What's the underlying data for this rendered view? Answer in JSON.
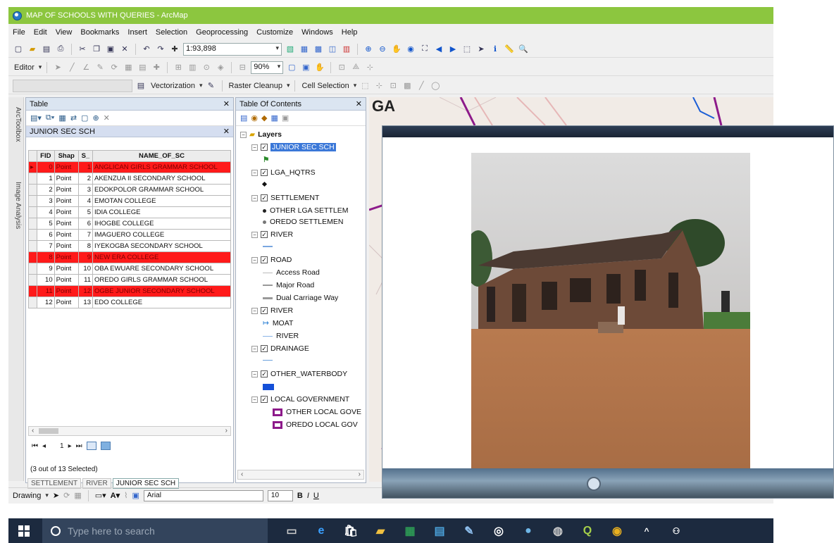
{
  "window": {
    "title": "MAP OF SCHOOLS WITH QUERIES - ArcMap"
  },
  "menu": [
    "File",
    "Edit",
    "View",
    "Bookmarks",
    "Insert",
    "Selection",
    "Geoprocessing",
    "Customize",
    "Windows",
    "Help"
  ],
  "toolbar": {
    "scale": "1:93,898",
    "editor_label": "Editor",
    "zoom_pct": "90%",
    "vectorization_label": "Vectorization",
    "raster_cleanup_label": "Raster Cleanup",
    "cell_selection_label": "Cell Selection"
  },
  "side_tabs": {
    "arctoolbox": "ArcToolbox",
    "image_analysis": "Image Analysis"
  },
  "table": {
    "panel_title": "Table",
    "layer_name": "JUNIOR SEC SCH",
    "columns": [
      "FID",
      "Shap",
      "S_",
      "NAME_OF_SC"
    ],
    "rows": [
      {
        "fid": "0",
        "shape": "Point",
        "s": "1",
        "name": "ANGLICAN GIRLS GRAMMAR SCHOOL",
        "selected": true
      },
      {
        "fid": "1",
        "shape": "Point",
        "s": "2",
        "name": "AKENZUA II SECONDARY SCHOOL",
        "selected": false
      },
      {
        "fid": "2",
        "shape": "Point",
        "s": "3",
        "name": "EDOKPOLOR GRAMMAR SCHOOL",
        "selected": false
      },
      {
        "fid": "3",
        "shape": "Point",
        "s": "4",
        "name": "EMOTAN COLLEGE",
        "selected": false
      },
      {
        "fid": "4",
        "shape": "Point",
        "s": "5",
        "name": "IDIA COLLEGE",
        "selected": false
      },
      {
        "fid": "5",
        "shape": "Point",
        "s": "6",
        "name": "IHOGBE COLLEGE",
        "selected": false
      },
      {
        "fid": "6",
        "shape": "Point",
        "s": "7",
        "name": "IMAGUERO COLLEGE",
        "selected": false
      },
      {
        "fid": "7",
        "shape": "Point",
        "s": "8",
        "name": "IYEKOGBA SECONDARY SCHOOL",
        "selected": false
      },
      {
        "fid": "8",
        "shape": "Point",
        "s": "9",
        "name": "NEW ERA COLLEGE",
        "selected": true
      },
      {
        "fid": "9",
        "shape": "Point",
        "s": "10",
        "name": "OBA EWUARE SECONDARY SCHOOL",
        "selected": false
      },
      {
        "fid": "10",
        "shape": "Point",
        "s": "11",
        "name": "OREDO GIRLS GRAMMAR SCHOOL",
        "selected": false
      },
      {
        "fid": "11",
        "shape": "Point",
        "s": "12",
        "name": "OGBE JUNIOR SECONDARY SCHOOL",
        "selected": true
      },
      {
        "fid": "12",
        "shape": "Point",
        "s": "13",
        "name": "EDO COLLEGE",
        "selected": false
      }
    ],
    "nav_record": "1",
    "selection_status": "(3 out of 13 Selected)",
    "bottom_tabs": [
      "SETTLEMENT",
      "RIVER",
      "JUNIOR SEC SCH"
    ]
  },
  "toc": {
    "panel_title": "Table Of Contents",
    "root": "Layers",
    "layers": [
      {
        "name": "JUNIOR SEC SCH",
        "items": []
      },
      {
        "name": "LGA_HQTRS",
        "items": []
      },
      {
        "name": "SETTLEMENT",
        "items": [
          "OTHER LGA SETTLEM",
          "OREDO SETTLEMEN"
        ]
      },
      {
        "name": "RIVER",
        "items": []
      },
      {
        "name": "ROAD",
        "items": [
          "Access Road",
          "Major Road",
          "Dual Carriage Way"
        ]
      },
      {
        "name": "RIVER",
        "items": [
          "MOAT",
          "RIVER"
        ]
      },
      {
        "name": "DRAINAGE",
        "items": []
      },
      {
        "name": "OTHER_WATERBODY",
        "items": []
      },
      {
        "name": "LOCAL GOVERNMENT",
        "items": [
          "OTHER LOCAL GOVE",
          "OREDO LOCAL GOV"
        ]
      }
    ]
  },
  "map": {
    "title": "GA"
  },
  "drawing": {
    "label": "Drawing",
    "font": "Arial",
    "size": "10"
  },
  "taskbar": {
    "search_placeholder": "Type here to search"
  },
  "colors": {
    "title_green": "#8cc63f",
    "selection_red": "#ff1a1a",
    "taskbar": "#1c2a3f"
  }
}
